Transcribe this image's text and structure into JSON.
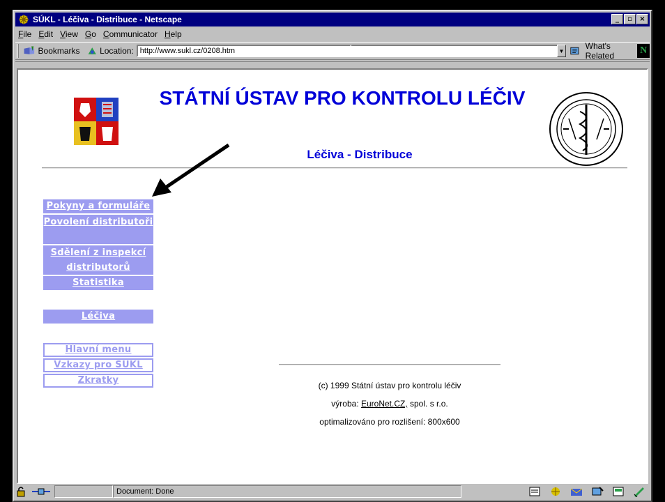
{
  "window": {
    "title": "SÚKL - Léčiva - Distribuce - Netscape",
    "buttons": [
      "_",
      "▫",
      "×"
    ]
  },
  "menu": [
    {
      "key": "F",
      "rest": "ile"
    },
    {
      "key": "E",
      "rest": "dit"
    },
    {
      "key": "V",
      "rest": "iew"
    },
    {
      "key": "G",
      "rest": "o"
    },
    {
      "key": "C",
      "rest": "ommunicator"
    },
    {
      "key": "H",
      "rest": "elp"
    }
  ],
  "toolbar": {
    "bookmarks_label": "Bookmarks",
    "location_label": "Location:",
    "url": "http://www.sukl.cz/0208.htm",
    "related_label": "What's Related"
  },
  "page": {
    "title": "STÁTNÍ ÚSTAV PRO KONTROLU LÉČIV",
    "subtitle": "Léčiva - Distribuce",
    "nav_primary": [
      "Pokyny a formuláře",
      "Povolení distributoři",
      "Sdělení z inspekcí distributorů",
      "Statistika"
    ],
    "nav_leciva": "Léčiva ",
    "nav_secondary": [
      "Hlavní menu",
      "Vzkazy pro SÚKL",
      "Zkratky"
    ],
    "footer": {
      "copyright": "(c) 1999 Státní ústav pro kontrolu léčiv",
      "made_by_prefix": "výroba: ",
      "made_by_link": "EuroNet.CZ,",
      "made_by_suffix": " spol. s r.o.",
      "optimized": "optimalizováno pro rozlišení: 800x600"
    }
  },
  "status": {
    "text": "Document: Done"
  },
  "colors": {
    "title_blue": "#0000d8",
    "nav_lavender": "#9c9cf0",
    "titlebar": "#000080"
  }
}
